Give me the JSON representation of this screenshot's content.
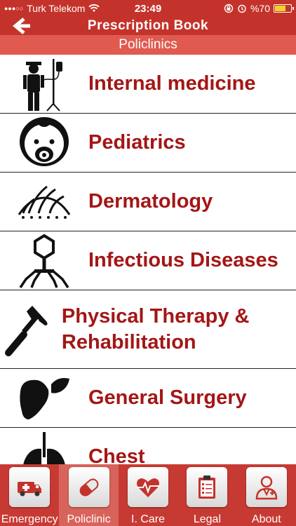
{
  "status_bar": {
    "signal": "●●●○○",
    "carrier": "Turk Telekom",
    "time": "23:49",
    "battery": "%70",
    "battery_level": 0.7
  },
  "nav": {
    "title": "Prescription Book"
  },
  "section": {
    "title": "Policlinics"
  },
  "list": [
    {
      "label": "Internal medicine",
      "icon": "patient-iv-icon"
    },
    {
      "label": "Pediatrics",
      "icon": "baby-icon"
    },
    {
      "label": "Dermatology",
      "icon": "skin-hair-icon"
    },
    {
      "label": "Infectious Diseases",
      "icon": "virus-icon"
    },
    {
      "label": "Physical Therapy & Rehabilitation",
      "icon": "reflex-hammer-icon"
    },
    {
      "label": "General Surgery",
      "icon": "liver-icon"
    },
    {
      "label": "Chest",
      "icon": "lungs-icon"
    }
  ],
  "tabs": [
    {
      "label": "Emergency",
      "icon": "ambulance-icon"
    },
    {
      "label": "Policlinic",
      "icon": "pill-icon",
      "active": true
    },
    {
      "label": "I. Care",
      "icon": "heart-monitor-icon"
    },
    {
      "label": "Legal",
      "icon": "clipboard-icon"
    },
    {
      "label": "About",
      "icon": "doctor-icon"
    }
  ],
  "colors": {
    "primary": "#c4332b",
    "secondary": "#e05a50",
    "label": "#a41616"
  }
}
